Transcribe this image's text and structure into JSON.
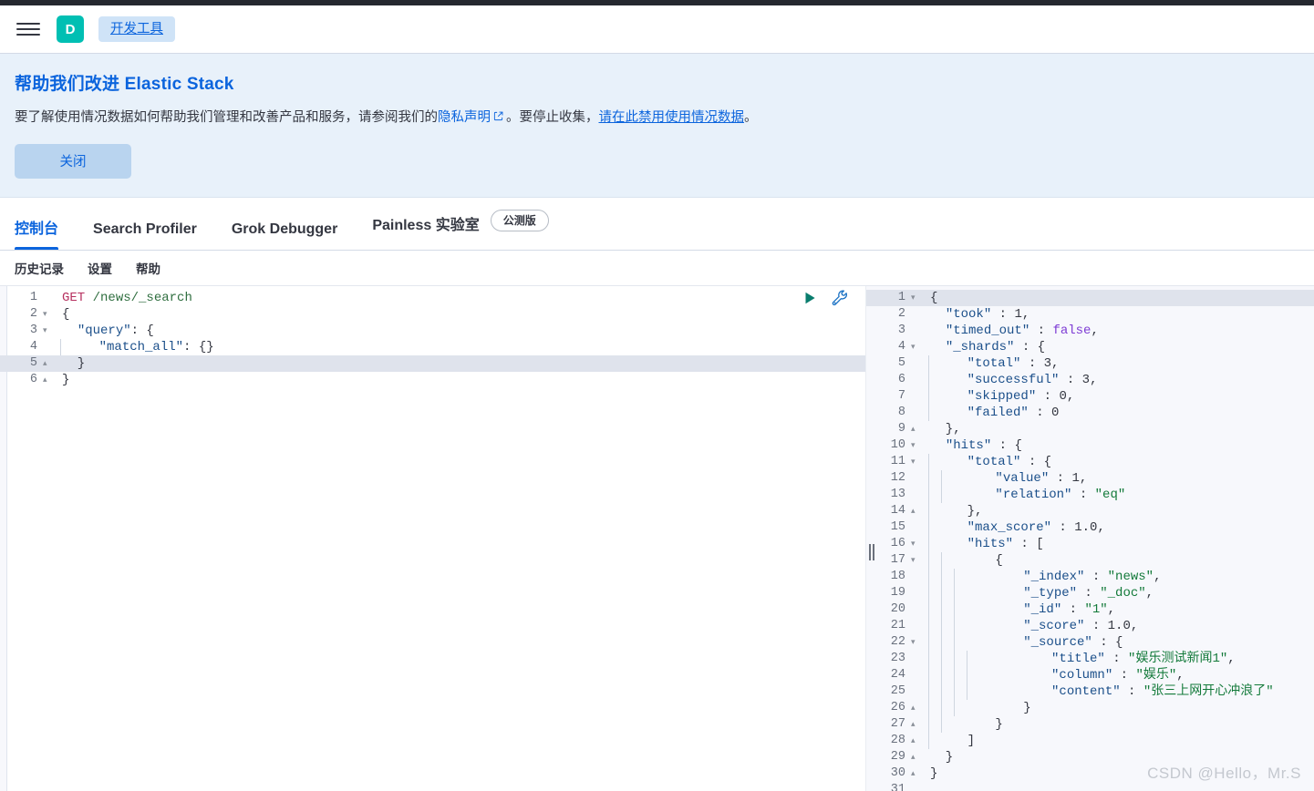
{
  "header": {
    "menu_icon": "hamburger-menu-icon",
    "avatar_initial": "D",
    "breadcrumb": "开发工具",
    "avatar_color": "#00bfb3",
    "breadcrumb_color": "#0b64dd"
  },
  "banner": {
    "title": "帮助我们改进 Elastic Stack",
    "text_before_link": "要了解使用情况数据如何帮助我们管理和改善产品和服务，请参阅我们的",
    "privacy_link": "隐私声明",
    "external_link_icon": "external-link-icon",
    "text_middle": "。要停止收集，",
    "disable_link": "请在此禁用使用情况数据",
    "text_after": "。",
    "dismiss_label": "关闭",
    "background": "#e8f1fa",
    "button_color": "#b9d4ef"
  },
  "tabs": [
    {
      "label": "控制台",
      "active": true
    },
    {
      "label": "Search Profiler",
      "active": false
    },
    {
      "label": "Grok Debugger",
      "active": false
    },
    {
      "label": "Painless 实验室",
      "active": false,
      "badge": "公测版"
    }
  ],
  "subnav": [
    {
      "label": "历史记录"
    },
    {
      "label": "设置"
    },
    {
      "label": "帮助"
    }
  ],
  "editor": {
    "run_icon": "play-button-icon",
    "wrench_icon": "wrench-icon",
    "run_icon_color": "#0a7d6e",
    "wrench_icon_color": "#1b72c4",
    "active_line": 5,
    "lines": [
      {
        "n": "1",
        "fold": "",
        "indent": 0,
        "text": "GET /news/_search"
      },
      {
        "n": "2",
        "fold": "▾",
        "indent": 0,
        "text": "{"
      },
      {
        "n": "3",
        "fold": "▾",
        "indent": 0,
        "text": "  \"query\": {"
      },
      {
        "n": "4",
        "fold": "",
        "indent": 1,
        "text": "    \"match_all\": {}"
      },
      {
        "n": "5",
        "fold": "▴",
        "indent": 0,
        "text": "  }"
      },
      {
        "n": "6",
        "fold": "▴",
        "indent": 0,
        "text": "}"
      }
    ]
  },
  "response": {
    "active_line": 1,
    "lines": [
      {
        "n": "1",
        "fold": "▾",
        "indent": 0,
        "text": "{"
      },
      {
        "n": "2",
        "fold": "",
        "indent": 0,
        "text": "  \"took\" : 1,"
      },
      {
        "n": "3",
        "fold": "",
        "indent": 0,
        "text": "  \"timed_out\" : false,"
      },
      {
        "n": "4",
        "fold": "▾",
        "indent": 0,
        "text": "  \"_shards\" : {"
      },
      {
        "n": "5",
        "fold": "",
        "indent": 1,
        "text": "    \"total\" : 3,"
      },
      {
        "n": "6",
        "fold": "",
        "indent": 1,
        "text": "    \"successful\" : 3,"
      },
      {
        "n": "7",
        "fold": "",
        "indent": 1,
        "text": "    \"skipped\" : 0,"
      },
      {
        "n": "8",
        "fold": "",
        "indent": 1,
        "text": "    \"failed\" : 0"
      },
      {
        "n": "9",
        "fold": "▴",
        "indent": 0,
        "text": "  },"
      },
      {
        "n": "10",
        "fold": "▾",
        "indent": 0,
        "text": "  \"hits\" : {"
      },
      {
        "n": "11",
        "fold": "▾",
        "indent": 1,
        "text": "    \"total\" : {"
      },
      {
        "n": "12",
        "fold": "",
        "indent": 2,
        "text": "      \"value\" : 1,"
      },
      {
        "n": "13",
        "fold": "",
        "indent": 2,
        "text": "      \"relation\" : \"eq\""
      },
      {
        "n": "14",
        "fold": "▴",
        "indent": 1,
        "text": "    },"
      },
      {
        "n": "15",
        "fold": "",
        "indent": 1,
        "text": "    \"max_score\" : 1.0,"
      },
      {
        "n": "16",
        "fold": "▾",
        "indent": 1,
        "text": "    \"hits\" : ["
      },
      {
        "n": "17",
        "fold": "▾",
        "indent": 2,
        "text": "      {"
      },
      {
        "n": "18",
        "fold": "",
        "indent": 3,
        "text": "        \"_index\" : \"news\","
      },
      {
        "n": "19",
        "fold": "",
        "indent": 3,
        "text": "        \"_type\" : \"_doc\","
      },
      {
        "n": "20",
        "fold": "",
        "indent": 3,
        "text": "        \"_id\" : \"1\","
      },
      {
        "n": "21",
        "fold": "",
        "indent": 3,
        "text": "        \"_score\" : 1.0,"
      },
      {
        "n": "22",
        "fold": "▾",
        "indent": 3,
        "text": "        \"_source\" : {"
      },
      {
        "n": "23",
        "fold": "",
        "indent": 4,
        "text": "          \"title\" : \"娱乐测试新闻1\","
      },
      {
        "n": "24",
        "fold": "",
        "indent": 4,
        "text": "          \"column\" : \"娱乐\","
      },
      {
        "n": "25",
        "fold": "",
        "indent": 4,
        "text": "          \"content\" : \"张三上网开心冲浪了\""
      },
      {
        "n": "26",
        "fold": "▴",
        "indent": 3,
        "text": "        }"
      },
      {
        "n": "27",
        "fold": "▴",
        "indent": 2,
        "text": "      }"
      },
      {
        "n": "28",
        "fold": "▴",
        "indent": 1,
        "text": "    ]"
      },
      {
        "n": "29",
        "fold": "▴",
        "indent": 0,
        "text": "  }"
      },
      {
        "n": "30",
        "fold": "▴",
        "indent": 0,
        "text": "}"
      },
      {
        "n": "31",
        "fold": "",
        "indent": 0,
        "text": ""
      }
    ]
  },
  "drag_handle": "pane-resize-handle",
  "watermark": "CSDN @Hello，Mr.S"
}
